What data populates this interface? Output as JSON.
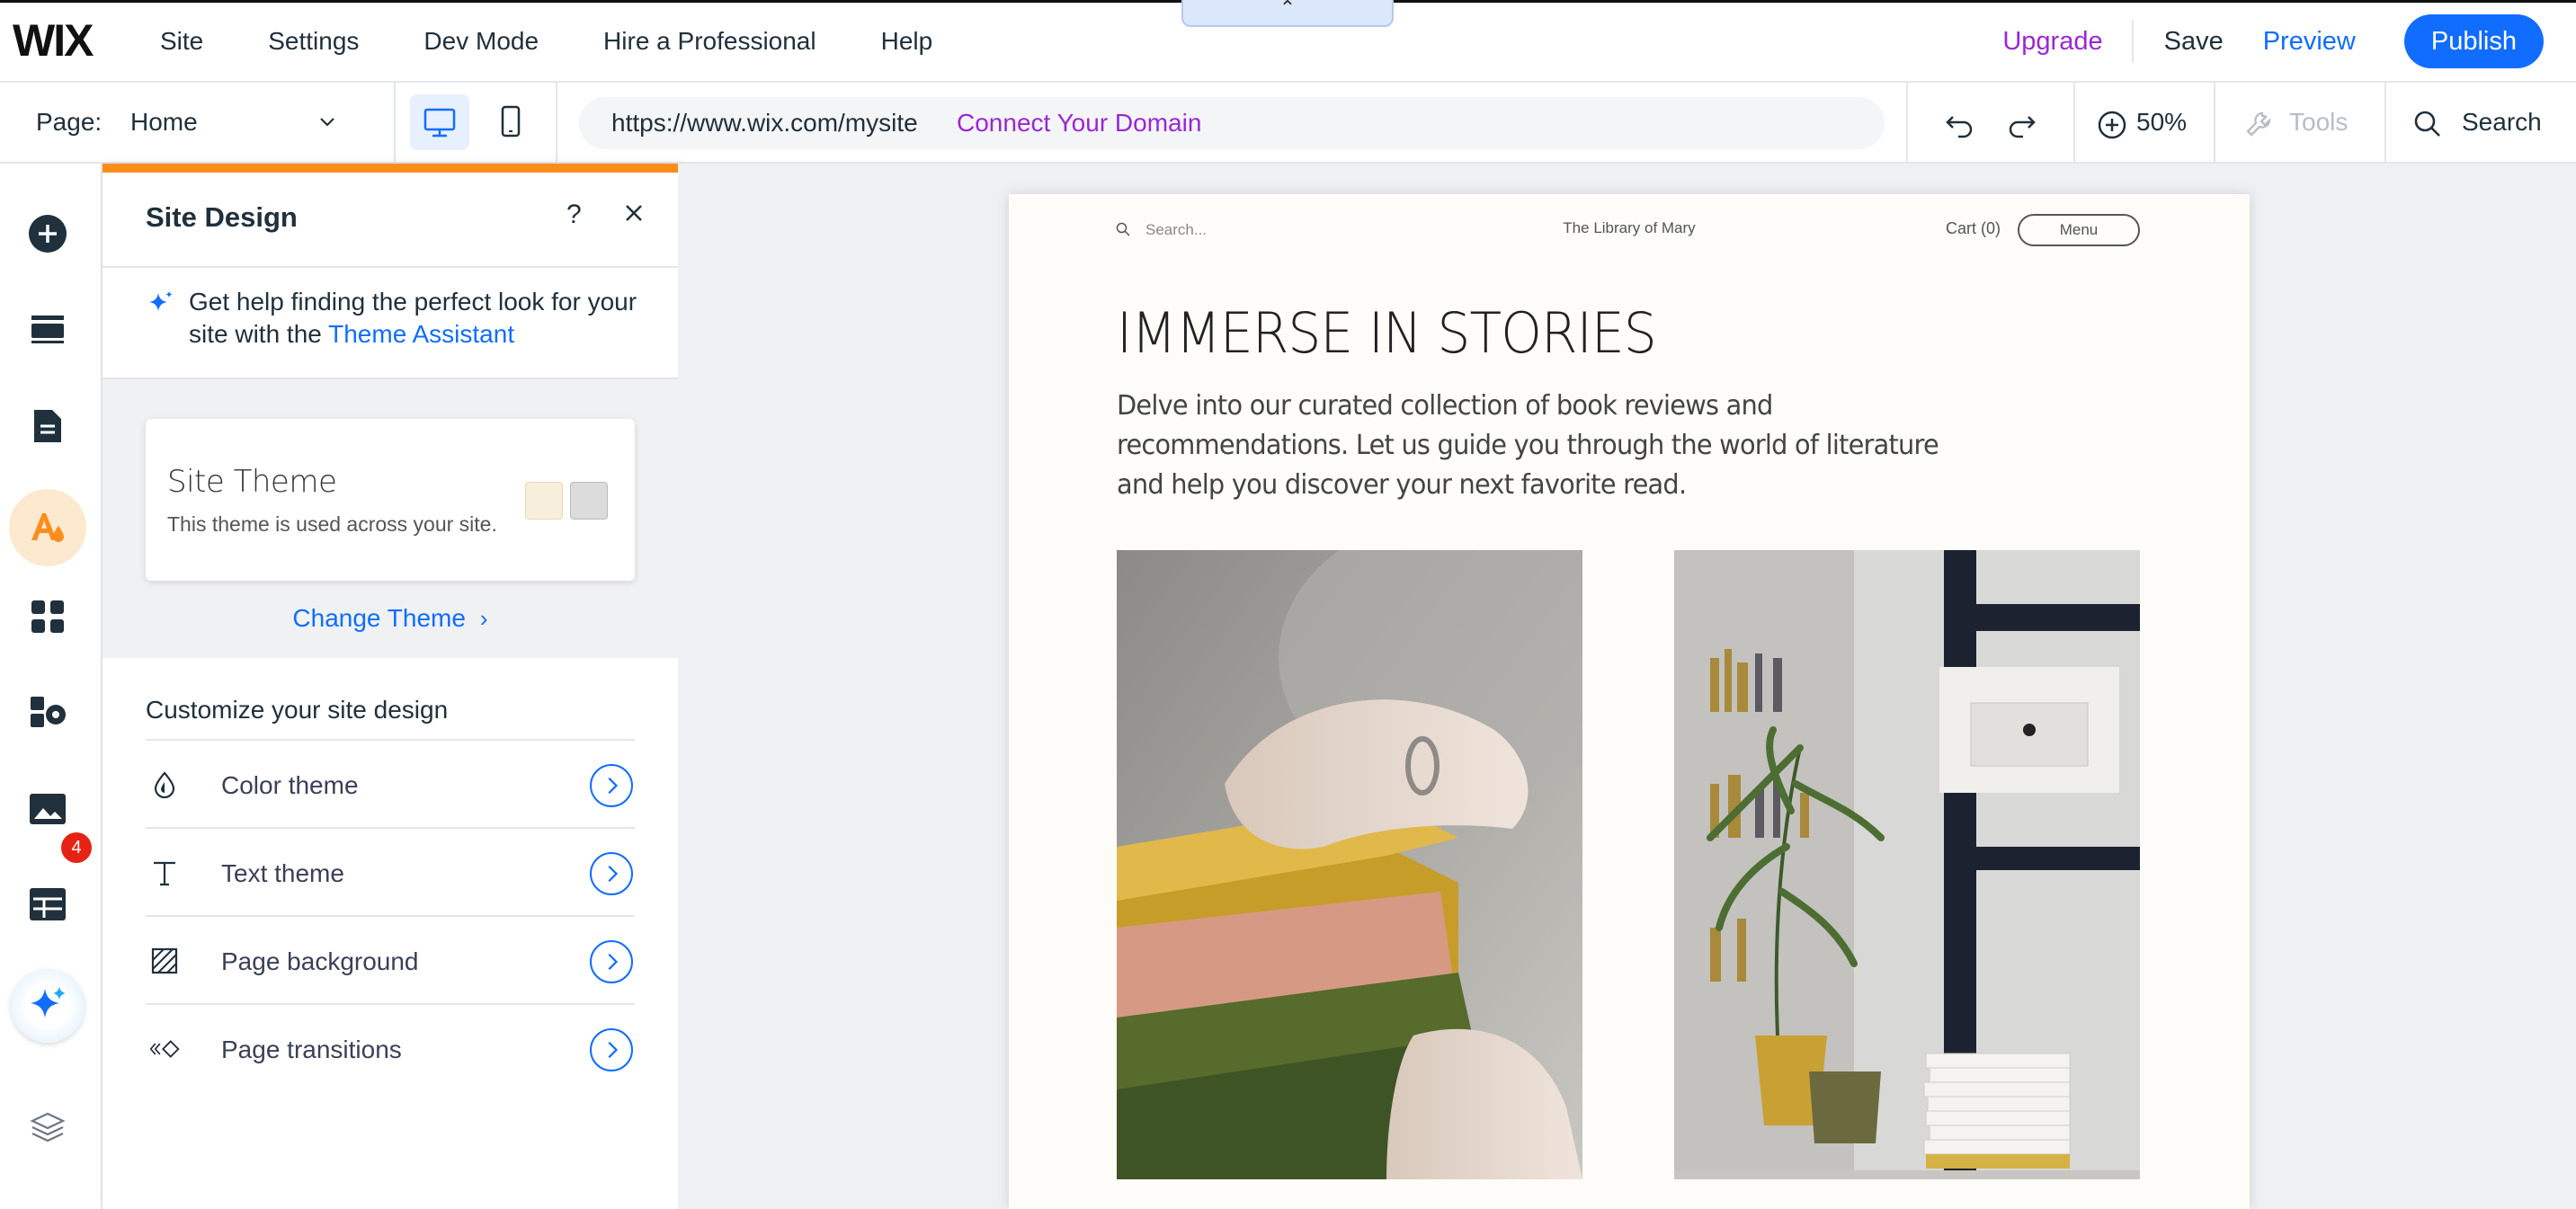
{
  "topbar": {
    "logo": "WIX",
    "menu": [
      "Site",
      "Settings",
      "Dev Mode",
      "Hire a Professional",
      "Help"
    ],
    "upgrade": "Upgrade",
    "save": "Save",
    "preview": "Preview",
    "publish": "Publish",
    "handle_icon": "chevron-up-icon"
  },
  "secondbar": {
    "page_label": "Page:",
    "page_value": "Home",
    "url": "https://www.wix.com/mysite",
    "connect_domain": "Connect Your Domain",
    "zoom": "50%",
    "tools": "Tools",
    "search": "Search"
  },
  "rail": {
    "items": [
      "add",
      "sections",
      "pages",
      "site-design",
      "apps",
      "business-tools",
      "media",
      "cms",
      "ai-assistant",
      "layers"
    ],
    "badge": "4",
    "active": "site-design"
  },
  "panel": {
    "title": "Site Design",
    "help": "?",
    "assist_text": "Get help finding the perfect look for your site with the ",
    "assist_link": "Theme Assistant",
    "theme_name": "Site Theme",
    "theme_sub": "This theme is used across your site.",
    "change_theme": "Change Theme",
    "customize_title": "Customize your site design",
    "items": [
      {
        "label": "Color theme",
        "icon": "droplet-icon"
      },
      {
        "label": "Text theme",
        "icon": "text-icon"
      },
      {
        "label": "Page background",
        "icon": "background-icon"
      },
      {
        "label": "Page transitions",
        "icon": "transitions-icon"
      }
    ],
    "swatches": [
      "#f7efdc",
      "#dcdcdc"
    ]
  },
  "site": {
    "search_placeholder": "Search...",
    "brand": "The Library of Mary",
    "cart": "Cart (0)",
    "menu": "Menu",
    "hero": "IMMERSE IN STORIES",
    "description": "Delve into our curated collection of book reviews and recommendations. Let us guide you through the world of literature and help you discover your next favorite read."
  },
  "colors": {
    "accent": "#116dff",
    "upgrade": "#9a27d5",
    "panel_top": "#fb8e1a",
    "badge": "#e62214"
  }
}
